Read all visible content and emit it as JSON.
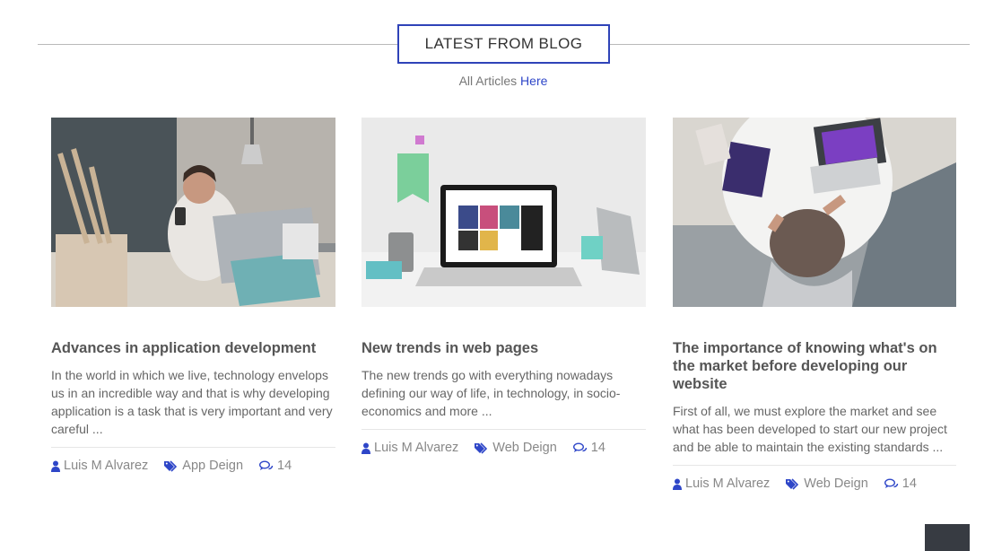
{
  "header": {
    "title": "LATEST FROM BLOG",
    "subtitle_prefix": "All Articles",
    "subtitle_link": "Here"
  },
  "posts": [
    {
      "title": "Advances in application development",
      "excerpt": "In the world in which we live, technology envelops us in an incredible way and that is why developing application is a task that is very important and very careful ...",
      "author": "Luis M Alvarez",
      "category": "App Deign",
      "comments": "14",
      "image": "woman-with-phone-and-laptop-photo"
    },
    {
      "title": "New trends in web pages",
      "excerpt": "The new trends go with everything nowadays defining our way of life, in technology, in socio-economics and more ...",
      "author": "Luis M Alvarez",
      "category": "Web Deign",
      "comments": "14",
      "image": "laptop-on-desk-photo"
    },
    {
      "title": "The importance of knowing what's on the market before developing our website",
      "excerpt": "First of all, we must explore the market and see what has been developed to start our new project and be able to maintain the existing standards ...",
      "author": "Luis M Alvarez",
      "category": "Web Deign",
      "comments": "14",
      "image": "top-view-person-laptop-photo"
    }
  ],
  "colors": {
    "accent": "#2e46c8",
    "scroll_button": "#373b42"
  },
  "icons": {
    "author": "user-icon",
    "category": "tags-icon",
    "comments": "comments-icon"
  }
}
